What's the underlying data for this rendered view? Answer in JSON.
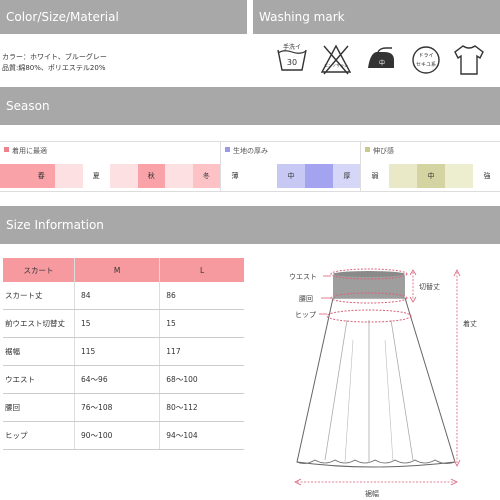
{
  "sections": {
    "color": "Color/Size/Material",
    "washing": "Washing mark",
    "season": "Season",
    "size": "Size Information"
  },
  "material": {
    "line1": "カラー：ホワイト、ブルーグレー",
    "line2": "品質:綿80%、ポリエステル20%"
  },
  "washing_marks": [
    {
      "icon": "hand-wash-30-icon",
      "label1": "手洗イ",
      "label2": "30"
    },
    {
      "icon": "no-bleach-icon",
      "label1": "エンソサラシ"
    },
    {
      "icon": "iron-medium-icon",
      "label1": "中"
    },
    {
      "icon": "dry-clean-icon",
      "label1": "ドライ",
      "label2": "セキユ系"
    },
    {
      "icon": "garment-icon"
    }
  ],
  "season_info": {
    "season": {
      "title": "着用に最適",
      "marker_color": "#f0828c",
      "cells": [
        {
          "label": "",
          "color": "#f9a3a8"
        },
        {
          "label": "春",
          "color": "#f9a3a8"
        },
        {
          "label": "",
          "color": "#fde0e2"
        },
        {
          "label": "夏",
          "color": "#ffffff"
        },
        {
          "label": "",
          "color": "#fde0e2"
        },
        {
          "label": "秋",
          "color": "#f9a3a8"
        },
        {
          "label": "",
          "color": "#fde0e2"
        },
        {
          "label": "冬",
          "color": "#fcc2c6"
        }
      ]
    },
    "thickness": {
      "title": "生地の厚み",
      "marker_color": "#9a9ae6",
      "cells": [
        {
          "label": "薄",
          "color": "#ffffff"
        },
        {
          "label": "",
          "color": "#ffffff"
        },
        {
          "label": "中",
          "color": "#c8c8f5"
        },
        {
          "label": "",
          "color": "#a3a3f0"
        },
        {
          "label": "厚",
          "color": "#d6d6f8"
        }
      ]
    },
    "stretch": {
      "title": "伸び感",
      "marker_color": "#c9c98c",
      "cells": [
        {
          "label": "弱",
          "color": "#ffffff"
        },
        {
          "label": "",
          "color": "#e9e9c8"
        },
        {
          "label": "中",
          "color": "#d4d4a2"
        },
        {
          "label": "",
          "color": "#ededd0"
        },
        {
          "label": "強",
          "color": "#ffffff"
        }
      ]
    }
  },
  "size_table": {
    "headers": [
      "スカート",
      "M",
      "L"
    ],
    "rows": [
      [
        "スカート丈",
        "84",
        "86"
      ],
      [
        "前ウエスト切替丈",
        "15",
        "15"
      ],
      [
        "裾幅",
        "115",
        "117"
      ],
      [
        "ウエスト",
        "64〜96",
        "68〜100"
      ],
      [
        "腰回",
        "76〜108",
        "80〜112"
      ],
      [
        "ヒップ",
        "90〜100",
        "94〜104"
      ]
    ]
  },
  "diagram": {
    "waist": "ウエスト",
    "koshi": "腰回",
    "hip": "ヒップ",
    "switch_length": "切替丈",
    "length": "着丈",
    "hem_width": "裾幅",
    "accent": "#d9607a",
    "band_color": "#9e9e9e"
  }
}
